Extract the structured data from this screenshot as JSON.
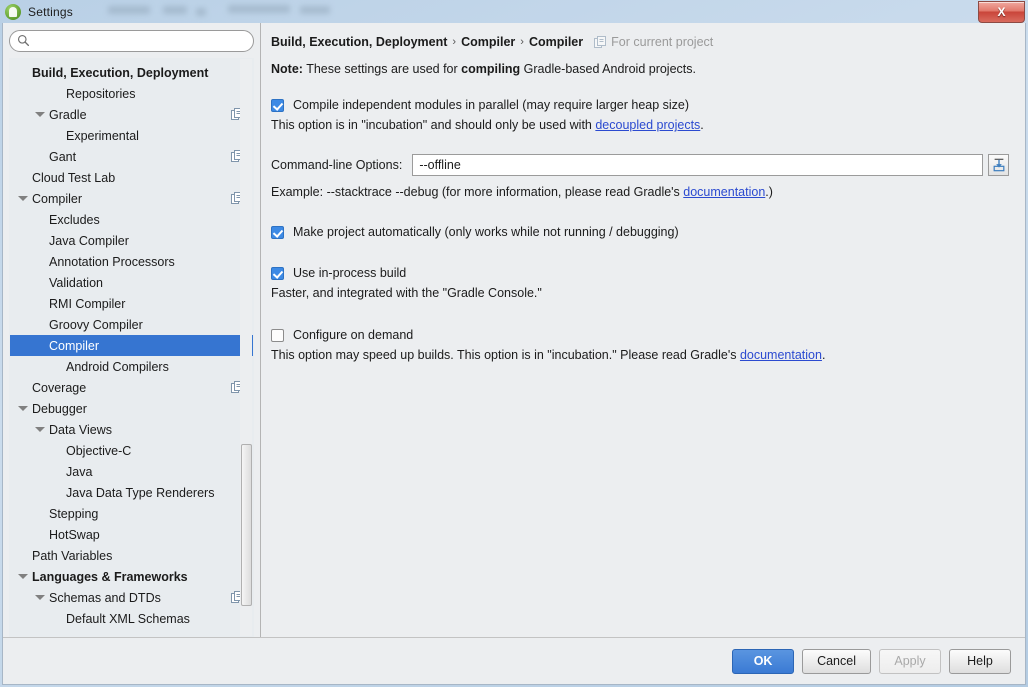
{
  "window": {
    "title": "Settings",
    "app_icon": "android-studio-icon",
    "close_label": "X"
  },
  "search": {
    "value": "",
    "placeholder": "",
    "icon": "search-icon"
  },
  "sidebar": {
    "scope_icon": "project-scope-icon",
    "items": [
      {
        "label": "Build, Execution, Deployment",
        "indent": 0,
        "bold": true,
        "arrow": "none",
        "scope_icon": false,
        "selected": false
      },
      {
        "label": "Repositories",
        "indent": 2,
        "bold": false,
        "arrow": "none",
        "scope_icon": false,
        "selected": false
      },
      {
        "label": "Gradle",
        "indent": 1,
        "bold": false,
        "arrow": "expanded",
        "scope_icon": true,
        "selected": false
      },
      {
        "label": "Experimental",
        "indent": 2,
        "bold": false,
        "arrow": "none",
        "scope_icon": false,
        "selected": false
      },
      {
        "label": "Gant",
        "indent": 1,
        "bold": false,
        "arrow": "none",
        "scope_icon": true,
        "selected": false
      },
      {
        "label": "Cloud Test Lab",
        "indent": 0,
        "bold": false,
        "arrow": "none",
        "scope_icon": false,
        "selected": false
      },
      {
        "label": "Compiler",
        "indent": 0,
        "bold": false,
        "arrow": "expanded",
        "scope_icon": true,
        "selected": false
      },
      {
        "label": "Excludes",
        "indent": 1,
        "bold": false,
        "arrow": "none",
        "scope_icon": false,
        "selected": false
      },
      {
        "label": "Java Compiler",
        "indent": 1,
        "bold": false,
        "arrow": "none",
        "scope_icon": false,
        "selected": false
      },
      {
        "label": "Annotation Processors",
        "indent": 1,
        "bold": false,
        "arrow": "none",
        "scope_icon": false,
        "selected": false
      },
      {
        "label": "Validation",
        "indent": 1,
        "bold": false,
        "arrow": "none",
        "scope_icon": false,
        "selected": false
      },
      {
        "label": "RMI Compiler",
        "indent": 1,
        "bold": false,
        "arrow": "none",
        "scope_icon": false,
        "selected": false
      },
      {
        "label": "Groovy Compiler",
        "indent": 1,
        "bold": false,
        "arrow": "none",
        "scope_icon": false,
        "selected": false
      },
      {
        "label": "Compiler",
        "indent": 1,
        "bold": false,
        "arrow": "none",
        "scope_icon": false,
        "selected": true
      },
      {
        "label": "Android Compilers",
        "indent": 2,
        "bold": false,
        "arrow": "none",
        "scope_icon": false,
        "selected": false
      },
      {
        "label": "Coverage",
        "indent": 0,
        "bold": false,
        "arrow": "none",
        "scope_icon": true,
        "selected": false
      },
      {
        "label": "Debugger",
        "indent": 0,
        "bold": false,
        "arrow": "expanded",
        "scope_icon": false,
        "selected": false
      },
      {
        "label": "Data Views",
        "indent": 1,
        "bold": false,
        "arrow": "expanded",
        "scope_icon": false,
        "selected": false
      },
      {
        "label": "Objective-C",
        "indent": 2,
        "bold": false,
        "arrow": "none",
        "scope_icon": false,
        "selected": false
      },
      {
        "label": "Java",
        "indent": 2,
        "bold": false,
        "arrow": "none",
        "scope_icon": false,
        "selected": false
      },
      {
        "label": "Java Data Type Renderers",
        "indent": 2,
        "bold": false,
        "arrow": "none",
        "scope_icon": false,
        "selected": false
      },
      {
        "label": "Stepping",
        "indent": 1,
        "bold": false,
        "arrow": "none",
        "scope_icon": false,
        "selected": false
      },
      {
        "label": "HotSwap",
        "indent": 1,
        "bold": false,
        "arrow": "none",
        "scope_icon": false,
        "selected": false
      },
      {
        "label": "Path Variables",
        "indent": 0,
        "bold": false,
        "arrow": "none",
        "scope_icon": false,
        "selected": false
      },
      {
        "label": "Languages & Frameworks",
        "indent": 0,
        "bold": true,
        "arrow": "expanded",
        "scope_icon": false,
        "selected": false
      },
      {
        "label": "Schemas and DTDs",
        "indent": 1,
        "bold": false,
        "arrow": "expanded",
        "scope_icon": true,
        "selected": false
      },
      {
        "label": "Default XML Schemas",
        "indent": 2,
        "bold": false,
        "arrow": "none",
        "scope_icon": false,
        "selected": false
      }
    ]
  },
  "main": {
    "breadcrumb": {
      "part1": "Build, Execution, Deployment",
      "sep1": "›",
      "part2": "Compiler",
      "sep2": "›",
      "part3": "Compiler",
      "scope_text": "For current project",
      "scope_icon": "project-scope-icon"
    },
    "note": {
      "prefix": "Note:",
      "text_a": " These settings are used for ",
      "emphasis": "compiling",
      "text_b": " Gradle-based Android projects."
    },
    "options": [
      {
        "id": "compile-parallel",
        "checked": true,
        "label": "Compile independent modules in parallel (may require larger heap size)",
        "desc_before": "This option is in \"incubation\" and should only be used with ",
        "link": "decoupled projects",
        "desc_after": "."
      },
      {
        "id": "make-project-automatically",
        "checked": true,
        "label": "Make project automatically (only works while not running / debugging)",
        "desc_before": "",
        "link": "",
        "desc_after": ""
      },
      {
        "id": "use-in-process-build",
        "checked": true,
        "label": "Use in-process build",
        "desc_before": "Faster, and integrated with the \"Gradle Console.\"",
        "link": "",
        "desc_after": ""
      },
      {
        "id": "configure-on-demand",
        "checked": false,
        "label": "Configure on demand",
        "desc_before": "This option may speed up builds. This option is in \"incubation.\" Please read Gradle's ",
        "link": "documentation",
        "desc_after": "."
      }
    ],
    "command_line": {
      "label": "Command-line Options:",
      "value": "--offline",
      "placeholder": "",
      "expand_icon": "insert-expand-icon",
      "example_before": "Example: --stacktrace --debug (for more information, please read Gradle's ",
      "example_link": "documentation",
      "example_after": ".)"
    }
  },
  "footer": {
    "ok": "OK",
    "cancel": "Cancel",
    "apply": "Apply",
    "help": "Help"
  },
  "colors": {
    "accent": "#3675d1",
    "primary_button": "#3a7ad4",
    "link": "#2b4ad0",
    "panel_bg": "#eceef0",
    "tree_bg": "#e8ecef"
  }
}
